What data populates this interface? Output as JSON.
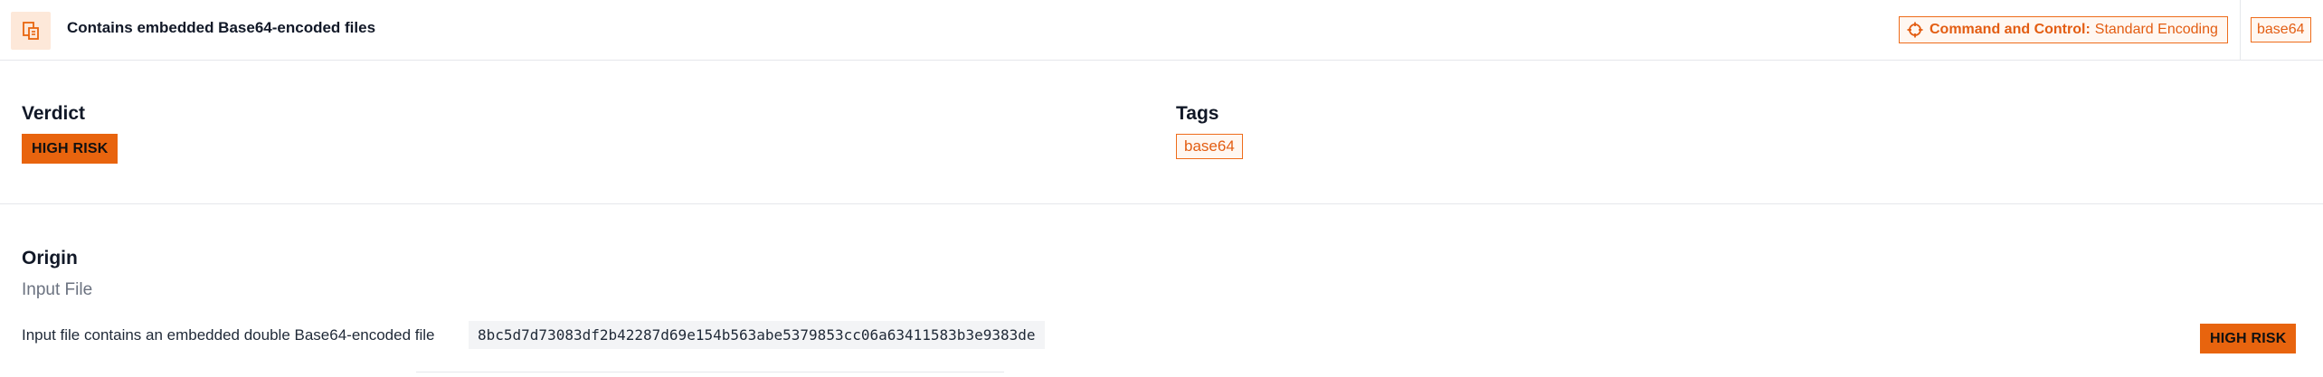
{
  "header": {
    "icon": "embedded-file-icon",
    "title": "Contains embedded Base64-encoded files",
    "mitre": {
      "icon": "crosshair-icon",
      "tactic": "Command and Control:",
      "technique": "Standard Encoding"
    },
    "tag": "base64"
  },
  "verdict": {
    "heading": "Verdict",
    "badge": "HIGH RISK"
  },
  "tags": {
    "heading": "Tags",
    "items": [
      "base64"
    ]
  },
  "origin": {
    "heading": "Origin",
    "subheading": "Input File",
    "description": "Input file contains an embedded double Base64-encoded file",
    "hash": "8bc5d7d73083df2b42287d69e154b563abe5379853cc06a63411583b3e9383de",
    "badge": "HIGH RISK"
  },
  "colors": {
    "accent": "#e8640e",
    "accent_light": "#fff7f1",
    "icon_bg": "#fde8d9"
  }
}
